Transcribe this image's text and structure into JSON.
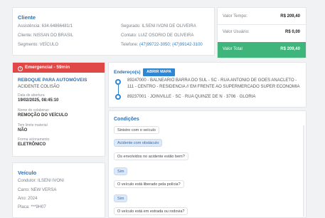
{
  "client": {
    "title": "Cliente",
    "assistencia": "Assistência: 634.64866481/1",
    "cliente": "Cliente: NISSAN DO BRASIL",
    "segmento": "Segmento: VEÍCULO",
    "segurado": "Segurado: ILSENI IVONI DE OLIVEIRA",
    "contato": "Contato: LUIZ OSORIO DE OLIVEIRA",
    "telefone_label": "Telefone: ",
    "telefone": "(47)99722-3050; (47)99142-3100"
  },
  "values": {
    "tempo_label": "Valor Tempo:",
    "tempo": "R$ 209,40",
    "usuario_label": "Valor Usuário:",
    "usuario": "R$ 0,00",
    "total_label": "Valor Total",
    "total": "R$ 209,40"
  },
  "emergency": {
    "header": "Emergencial - 59min",
    "service": "REBOQUE PARA AUTOMÓVEIS",
    "reason": "ACIDENTE COLISÃO",
    "open_label": "Data de abertura",
    "open_value": "19/02/2025, 08:45:10",
    "collab_label": "Nome do colaborao",
    "collab_value": "REMOÇÃO DO VEÍCULO",
    "material_label": "Tem limite material",
    "material_value": "NÃO",
    "mode_label": "Forma acionamento",
    "mode_value": "ELETRÔNICO"
  },
  "vehicle": {
    "title": "Veículo",
    "driver": "Condutor: ILSENI IVONI",
    "car": "Carro: NEW VERSA",
    "year": "Ano: 2024",
    "plate": "Placa: ***9H07"
  },
  "address": {
    "title": "Endereço(s)",
    "map_button": "ABRIR MAPA",
    "origin_line1": "89247000 - BALNEARIO BARRA DO SUL - SC - RUA ANTONIO DE GOES ANACLETO -",
    "origin_line2": "111 - CENTRO - RESIDENCIA // EM FRENTE AO SUPERMERCADO SUPER ECONOMIA",
    "destination": "89237001 · JOINVILLE · SC · RUA QUINZE DE N · 3706 · GLORIA"
  },
  "conditions": {
    "title": "Condições",
    "items": [
      "Sinistro com o veículo",
      "Acidente com obstáculo",
      "Os envolvidos no acidente estão bem?",
      "Sim",
      "O veículo está liberado pela polícia?",
      "Sim",
      "O veículo está em estrada ou rodovia?"
    ]
  },
  "colors": {
    "accent": "#2f6fb1",
    "emergency": "#e04848",
    "total": "#3fb47b"
  }
}
